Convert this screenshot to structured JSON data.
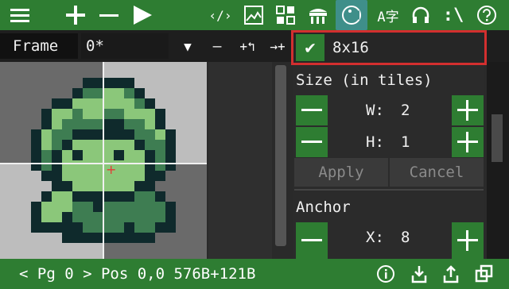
{
  "toolbar": {
    "icons": [
      "menu-icon",
      "add-icon",
      "remove-icon",
      "play-icon",
      "code-icon",
      "image-icon",
      "tiles-icon",
      "store-icon",
      "sprite-icon",
      "font-icon",
      "headphones-icon",
      "script-icon",
      "help-icon"
    ],
    "code_glyph": "‹/›",
    "font_glyph": "A字",
    "script_glyph": ":\\"
  },
  "frame": {
    "label": "Frame",
    "value": "0*"
  },
  "frame_tools": {
    "dropdown_glyph": "▼",
    "remove_glyph": "—",
    "add_glyph": "+↰",
    "next_glyph": "→+"
  },
  "size_dropdown": {
    "selected": "8x16",
    "check_glyph": "✔"
  },
  "panel": {
    "size_title": "Size (in tiles)",
    "width_label": "W:",
    "width_value": "2",
    "height_label": "H:",
    "height_value": "1",
    "apply_label": "Apply",
    "cancel_label": "Cancel",
    "anchor_title": "Anchor",
    "anchor_x_label": "X:",
    "anchor_x_value": "8",
    "minus_glyph": "—",
    "plus_glyph": "+"
  },
  "status": {
    "text": "< Pg 0 > Pos 0,0 576B+121B"
  },
  "status_icons": [
    "info-icon",
    "import-icon",
    "export-icon",
    "copy-icon"
  ],
  "colors": {
    "accent": "#2e7d32",
    "selection_border": "#d32f2f",
    "sprite_light": "#8bc77a",
    "sprite_mid": "#3e7d52",
    "sprite_dark": "#0f2a2c"
  }
}
